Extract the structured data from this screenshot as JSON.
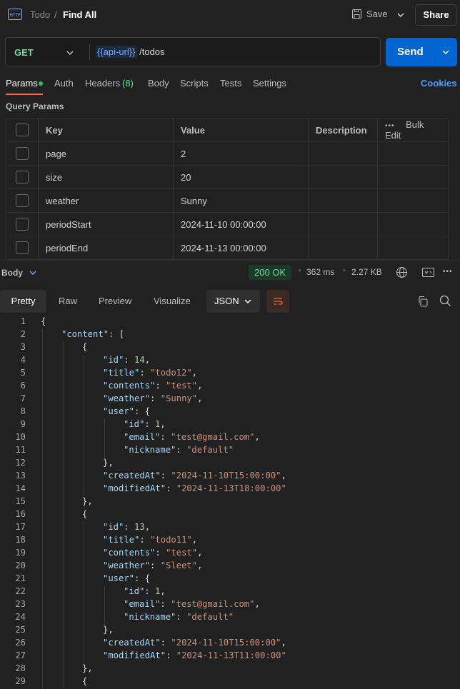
{
  "header": {
    "collection": "Todo",
    "separator": "/",
    "request_name": "Find All",
    "save_label": "Save",
    "share_label": "Share"
  },
  "request": {
    "method": "GET",
    "url_variable": "{{api-url}}",
    "url_path": " /todos",
    "send_label": "Send"
  },
  "tabs": {
    "params": "Params",
    "auth": "Auth",
    "headers": "Headers",
    "headers_count": "(8)",
    "body": "Body",
    "scripts": "Scripts",
    "tests": "Tests",
    "settings": "Settings",
    "cookies": "Cookies"
  },
  "query_params": {
    "title": "Query Params",
    "columns": {
      "key": "Key",
      "value": "Value",
      "description": "Description",
      "bulk_edit": "Bulk Edit"
    },
    "rows": [
      {
        "key": "page",
        "value": "2"
      },
      {
        "key": "size",
        "value": "20"
      },
      {
        "key": "weather",
        "value": "Sunny"
      },
      {
        "key": "periodStart",
        "value": "2024-11-10 00:00:00"
      },
      {
        "key": "periodEnd",
        "value": "2024-11-13 00:00:00"
      }
    ]
  },
  "response": {
    "label": "Body",
    "status": "200 OK",
    "time": "362 ms",
    "size": "2.27 KB",
    "views": {
      "pretty": "Pretty",
      "raw": "Raw",
      "preview": "Preview",
      "visualize": "Visualize"
    },
    "format": "JSON"
  },
  "colors": {
    "accent": "#f26b3a",
    "send": "#0265d2",
    "ok": "#6bdd9a",
    "link": "#45a0ff"
  },
  "code_lines": [
    {
      "n": "1",
      "indent": 0,
      "html": "{"
    },
    {
      "n": "2",
      "indent": 1,
      "html": "<span class=\"k\">\"content\"</span>: ["
    },
    {
      "n": "3",
      "indent": 2,
      "html": "{"
    },
    {
      "n": "4",
      "indent": 3,
      "html": "<span class=\"k\">\"id\"</span>: <span class=\"n\">14</span>,"
    },
    {
      "n": "5",
      "indent": 3,
      "html": "<span class=\"k\">\"title\"</span>: <span class=\"s\">\"todo12\"</span>,"
    },
    {
      "n": "6",
      "indent": 3,
      "html": "<span class=\"k\">\"contents\"</span>: <span class=\"s\">\"test\"</span>,"
    },
    {
      "n": "7",
      "indent": 3,
      "html": "<span class=\"k\">\"weather\"</span>: <span class=\"s\">\"Sunny\"</span>,"
    },
    {
      "n": "8",
      "indent": 3,
      "html": "<span class=\"k\">\"user\"</span>: {"
    },
    {
      "n": "9",
      "indent": 4,
      "html": "<span class=\"k\">\"id\"</span>: <span class=\"n\">1</span>,"
    },
    {
      "n": "10",
      "indent": 4,
      "html": "<span class=\"k\">\"email\"</span>: <span class=\"s\">\"test@gmail.com\"</span>,"
    },
    {
      "n": "11",
      "indent": 4,
      "html": "<span class=\"k\">\"nickname\"</span>: <span class=\"s\">\"default\"</span>"
    },
    {
      "n": "12",
      "indent": 3,
      "html": "},"
    },
    {
      "n": "13",
      "indent": 3,
      "html": "<span class=\"k\">\"createdAt\"</span>: <span class=\"s\">\"2024-11-10T15:00:00\"</span>,"
    },
    {
      "n": "14",
      "indent": 3,
      "html": "<span class=\"k\">\"modifiedAt\"</span>: <span class=\"s\">\"2024-11-13T18:00:00\"</span>"
    },
    {
      "n": "15",
      "indent": 2,
      "html": "},"
    },
    {
      "n": "16",
      "indent": 2,
      "html": "{"
    },
    {
      "n": "17",
      "indent": 3,
      "html": "<span class=\"k\">\"id\"</span>: <span class=\"n\">13</span>,"
    },
    {
      "n": "18",
      "indent": 3,
      "html": "<span class=\"k\">\"title\"</span>: <span class=\"s\">\"todo11\"</span>,"
    },
    {
      "n": "19",
      "indent": 3,
      "html": "<span class=\"k\">\"contents\"</span>: <span class=\"s\">\"test\"</span>,"
    },
    {
      "n": "20",
      "indent": 3,
      "html": "<span class=\"k\">\"weather\"</span>: <span class=\"s\">\"Sleet\"</span>,"
    },
    {
      "n": "21",
      "indent": 3,
      "html": "<span class=\"k\">\"user\"</span>: {"
    },
    {
      "n": "22",
      "indent": 4,
      "html": "<span class=\"k\">\"id\"</span>: <span class=\"n\">1</span>,"
    },
    {
      "n": "23",
      "indent": 4,
      "html": "<span class=\"k\">\"email\"</span>: <span class=\"s\">\"test@gmail.com\"</span>,"
    },
    {
      "n": "24",
      "indent": 4,
      "html": "<span class=\"k\">\"nickname\"</span>: <span class=\"s\">\"default\"</span>"
    },
    {
      "n": "25",
      "indent": 3,
      "html": "},"
    },
    {
      "n": "26",
      "indent": 3,
      "html": "<span class=\"k\">\"createdAt\"</span>: <span class=\"s\">\"2024-11-10T15:00:00\"</span>,"
    },
    {
      "n": "27",
      "indent": 3,
      "html": "<span class=\"k\">\"modifiedAt\"</span>: <span class=\"s\">\"2024-11-13T11:00:00\"</span>"
    },
    {
      "n": "28",
      "indent": 2,
      "html": "},"
    },
    {
      "n": "29",
      "indent": 2,
      "html": "{"
    }
  ]
}
